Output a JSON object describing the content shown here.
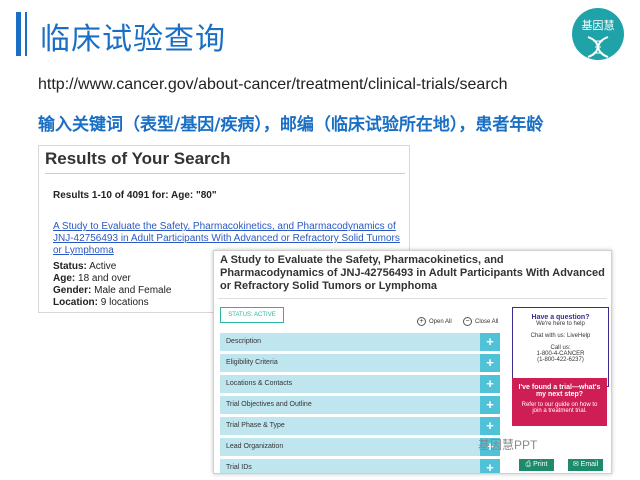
{
  "slide": {
    "title": "临床试验查询",
    "url": "http://www.cancer.gov/about-cancer/treatment/clinical-trials/search",
    "subtitle": "输入关键词（表型/基因/疾病），邮编（临床试验所在地），患者年龄",
    "logo_text": "基因慧",
    "logo_icon": "dna-icon",
    "accent": "#1a6fc4"
  },
  "results_panel": {
    "heading": "Results of Your Search",
    "count": "Results 1-10 of 4091 for: Age: \"80\"",
    "trial_link": "A Study to Evaluate the Safety, Pharmacokinetics, and Pharmacodynamics of JNJ-42756493 in Adult Participants With Advanced or Refractory Solid Tumors or Lymphoma",
    "status_label": "Status:",
    "status_value": "Active",
    "age_label": "Age:",
    "age_value": "18 and over",
    "gender_label": "Gender:",
    "gender_value": "Male and Female",
    "location_label": "Location:",
    "location_value": "9 locations"
  },
  "detail_panel": {
    "title": "A Study to Evaluate the Safety, Pharmacokinetics, and Pharmacodynamics of JNJ-42756493 in Adult Participants With Advanced or Refractory Solid Tumors or Lymphoma",
    "status_badge": "STATUS: ACTIVE",
    "open_all": "Open All",
    "close_all": "Close All",
    "sections": [
      "Description",
      "Eligibility Criteria",
      "Locations & Contacts",
      "Trial Objectives and Outline",
      "Trial Phase & Type",
      "Lead Organization",
      "Trial IDs"
    ],
    "question_box": {
      "title": "Have a question?",
      "subtitle": "We're here to help",
      "chat": "Chat with us: LiveHelp",
      "call": "Call us:",
      "phone1": "1-800-4-CANCER",
      "phone2": "(1-800-422-6237)"
    },
    "next_step_box": {
      "title": "I've found a trial—what's my next step?",
      "body": "Refer to our guide on how to join a treatment trial."
    },
    "print_label": "Print",
    "email_label": "Email"
  },
  "watermark": "基因慧PPT"
}
